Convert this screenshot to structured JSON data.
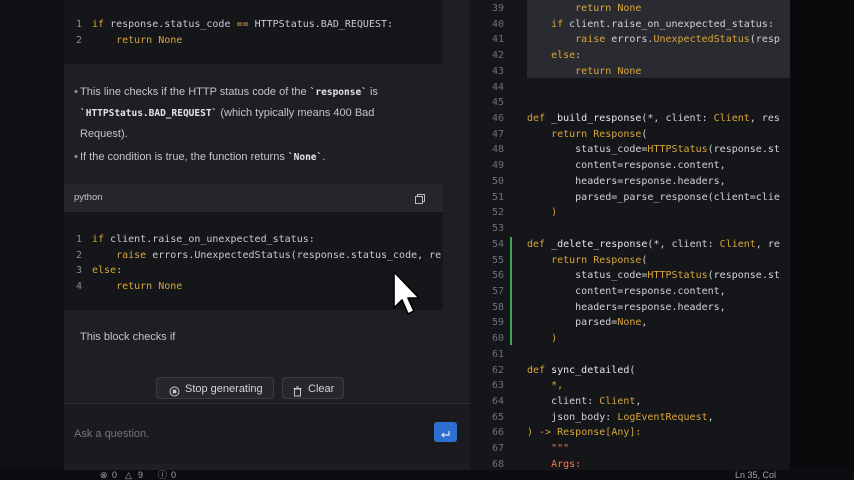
{
  "chat": {
    "block1": {
      "lines": [
        {
          "n": "1",
          "parts": [
            {
              "t": "if",
              "c": "kw"
            },
            {
              "t": " response.status_code "
            },
            {
              "t": "==",
              "c": "kw"
            },
            {
              "t": " HTTPStatus.BAD_REQUEST:"
            }
          ]
        },
        {
          "n": "2",
          "parts": [
            {
              "t": "    return",
              "c": "kw"
            },
            {
              "t": " None",
              "c": "kw"
            }
          ]
        }
      ]
    },
    "para1_a": "This line checks if the HTTP status code of the ",
    "para1_code1": "`response`",
    "para1_b": " is",
    "para1_code2": "`HTTPStatus.BAD_REQUEST`",
    "para1_c": " (which typically means 400 Bad",
    "para1_d": "Request).",
    "para2_a": "If the condition is true, the function returns ",
    "para2_code": "`None`",
    "para2_b": ".",
    "block2_lang": "python",
    "block2": {
      "lines": [
        {
          "n": "1",
          "parts": [
            {
              "t": "if",
              "c": "kw"
            },
            {
              "t": " client.raise_on_unexpected_status:"
            }
          ]
        },
        {
          "n": "2",
          "parts": [
            {
              "t": "    raise",
              "c": "kw"
            },
            {
              "t": " errors.UnexpectedStatus(response.status_code, re"
            }
          ]
        },
        {
          "n": "3",
          "parts": [
            {
              "t": "else",
              "c": "kw"
            },
            {
              "t": ":"
            }
          ]
        },
        {
          "n": "4",
          "parts": [
            {
              "t": "    return",
              "c": "kw"
            },
            {
              "t": " None",
              "c": "kw"
            }
          ]
        }
      ]
    },
    "para3": "This block checks if",
    "stop_label": "Stop generating",
    "clear_label": "Clear",
    "ask_placeholder": "Ask a question."
  },
  "editor": {
    "lines": [
      {
        "n": "39",
        "parts": [
          {
            "t": "        return",
            "c": "ek"
          },
          {
            "t": " None",
            "c": "ek"
          }
        ]
      },
      {
        "n": "40",
        "parts": [
          {
            "t": "    if",
            "c": "ek"
          },
          {
            "t": " client.raise_on_unexpected_status:"
          }
        ]
      },
      {
        "n": "41",
        "parts": [
          {
            "t": "        raise",
            "c": "ek"
          },
          {
            "t": " errors."
          },
          {
            "t": "UnexpectedStatus",
            "c": "et"
          },
          {
            "t": "(resp"
          }
        ]
      },
      {
        "n": "42",
        "parts": [
          {
            "t": "    else",
            "c": "ek"
          },
          {
            "t": ":"
          }
        ]
      },
      {
        "n": "43",
        "parts": [
          {
            "t": "        return",
            "c": "ek"
          },
          {
            "t": " None",
            "c": "ek"
          }
        ]
      },
      {
        "n": "44",
        "parts": []
      },
      {
        "n": "45",
        "parts": []
      },
      {
        "n": "46",
        "parts": [
          {
            "t": "def",
            "c": "ek"
          },
          {
            "t": " _build_response",
            "c": "ef"
          },
          {
            "t": "(*, client: "
          },
          {
            "t": "Client",
            "c": "et"
          },
          {
            "t": ", res"
          }
        ]
      },
      {
        "n": "47",
        "parts": [
          {
            "t": "    return",
            "c": "ek"
          },
          {
            "t": " "
          },
          {
            "t": "Response",
            "c": "et"
          },
          {
            "t": "("
          }
        ]
      },
      {
        "n": "48",
        "parts": [
          {
            "t": "        status_code="
          },
          {
            "t": "HTTPStatus",
            "c": "et"
          },
          {
            "t": "(response.st"
          }
        ]
      },
      {
        "n": "49",
        "parts": [
          {
            "t": "        content=response.content,"
          }
        ]
      },
      {
        "n": "50",
        "parts": [
          {
            "t": "        headers=response.headers,"
          }
        ]
      },
      {
        "n": "51",
        "parts": [
          {
            "t": "        parsed=_parse_response(client=clie"
          }
        ]
      },
      {
        "n": "52",
        "parts": [
          {
            "t": "    )",
            "c": "ek"
          }
        ]
      },
      {
        "n": "53",
        "parts": []
      },
      {
        "n": "54",
        "parts": [
          {
            "t": "def",
            "c": "ek"
          },
          {
            "t": " _delete_response",
            "c": "ef"
          },
          {
            "t": "(*, client: "
          },
          {
            "t": "Client",
            "c": "et"
          },
          {
            "t": ", re"
          }
        ]
      },
      {
        "n": "55",
        "parts": [
          {
            "t": "    return",
            "c": "ek"
          },
          {
            "t": " "
          },
          {
            "t": "Response",
            "c": "et"
          },
          {
            "t": "("
          }
        ]
      },
      {
        "n": "56",
        "parts": [
          {
            "t": "        status_code="
          },
          {
            "t": "HTTPStatus",
            "c": "et"
          },
          {
            "t": "(response.st"
          }
        ]
      },
      {
        "n": "57",
        "parts": [
          {
            "t": "        content=response.content,"
          }
        ]
      },
      {
        "n": "58",
        "parts": [
          {
            "t": "        headers=response.headers,"
          }
        ]
      },
      {
        "n": "59",
        "parts": [
          {
            "t": "        parsed="
          },
          {
            "t": "None",
            "c": "ek"
          },
          {
            "t": ","
          }
        ]
      },
      {
        "n": "60",
        "parts": [
          {
            "t": "    )",
            "c": "ek"
          }
        ]
      },
      {
        "n": "61",
        "parts": []
      },
      {
        "n": "62",
        "parts": [
          {
            "t": "def",
            "c": "ek"
          },
          {
            "t": " sync_detailed",
            "c": "ef"
          },
          {
            "t": "("
          }
        ]
      },
      {
        "n": "63",
        "parts": [
          {
            "t": "    *,",
            "c": "ek"
          }
        ]
      },
      {
        "n": "64",
        "parts": [
          {
            "t": "    client: "
          },
          {
            "t": "Client",
            "c": "et"
          },
          {
            "t": ","
          }
        ]
      },
      {
        "n": "65",
        "parts": [
          {
            "t": "    json_body: "
          },
          {
            "t": "LogEventRequest",
            "c": "et"
          },
          {
            "t": ","
          }
        ]
      },
      {
        "n": "66",
        "parts": [
          {
            "t": ") -> ",
            "c": "ek"
          },
          {
            "t": "Response",
            "c": "et"
          },
          {
            "t": "[",
            "c": "ek"
          },
          {
            "t": "Any",
            "c": "et"
          },
          {
            "t": "]:",
            "c": "ek"
          }
        ]
      },
      {
        "n": "67",
        "parts": [
          {
            "t": "    \"\"\"",
            "c": "ec"
          }
        ]
      },
      {
        "n": "68",
        "parts": [
          {
            "t": "    Args:",
            "c": "ec"
          }
        ]
      }
    ]
  },
  "status": {
    "errors": "0",
    "warnings": "9",
    "info": "0",
    "position": "Ln 35, Col"
  }
}
